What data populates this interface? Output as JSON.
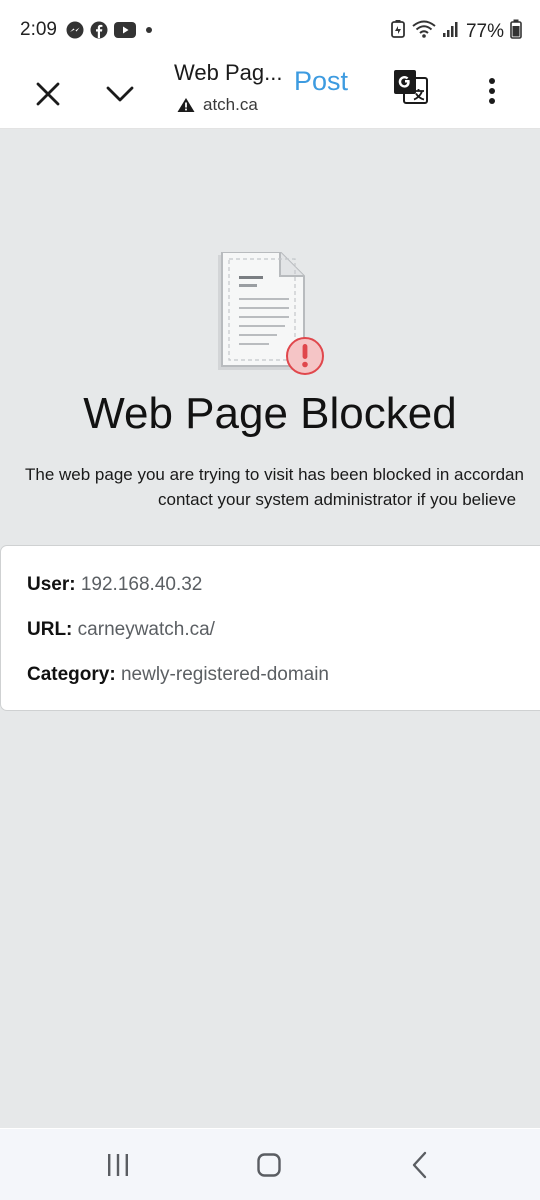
{
  "status_bar": {
    "time": "2:09",
    "battery": "77%",
    "left_icons": [
      "messenger-icon",
      "facebook-icon",
      "youtube-icon",
      "dot-icon"
    ],
    "right_icons": [
      "battery-saver-icon",
      "wifi-icon",
      "signal-icon",
      "battery-icon"
    ]
  },
  "toolbar": {
    "title": "Web Pag...",
    "url": "atch.ca",
    "post_label": "Post",
    "icons": [
      "close-icon",
      "chevron-down-icon",
      "warning-icon",
      "translate-icon",
      "more-vert-icon"
    ]
  },
  "page": {
    "heading": "Web Page Blocked",
    "description_line1": "The web page you are trying to visit has been blocked in accordan",
    "description_line2": "contact your system administrator if you believe",
    "info": {
      "user_label": "User:",
      "user_value": "192.168.40.32",
      "url_label": "URL:",
      "url_value": "carneywatch.ca/",
      "category_label": "Category:",
      "category_value": "newly-registered-domain"
    }
  },
  "nav_bar": {
    "icons": [
      "recents-icon",
      "home-icon",
      "back-icon"
    ]
  },
  "colors": {
    "accent": "#3d9be0",
    "page_background": "#e6e8e9",
    "alert_red": "#e0474c"
  }
}
